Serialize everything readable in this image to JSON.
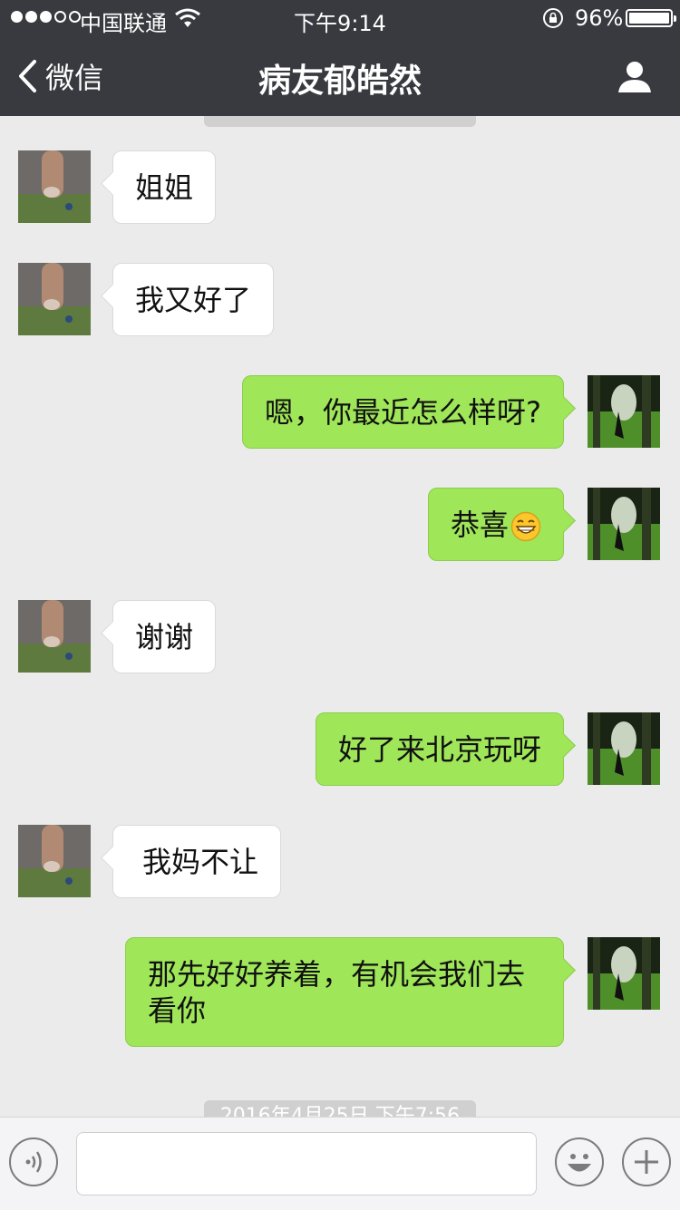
{
  "status_bar": {
    "carrier": "中国联通",
    "time": "下午9:14",
    "battery": "96%",
    "battery_level": 0.96,
    "signal_bars": 3
  },
  "nav": {
    "back_label": "微信",
    "title": "病友郁皓然"
  },
  "timestamps": {
    "bottom": "2016年4月25日 下午7:56"
  },
  "messages": [
    {
      "side": "left",
      "text": "姐姐"
    },
    {
      "side": "left",
      "text": "我又好了"
    },
    {
      "side": "right",
      "text": "嗯，你最近怎么样呀?"
    },
    {
      "side": "right",
      "text": "恭喜",
      "emoji": "grinning-face"
    },
    {
      "side": "left",
      "text": "谢谢"
    },
    {
      "side": "right",
      "text": "好了来北京玩呀"
    },
    {
      "side": "left",
      "text": "我妈不让"
    },
    {
      "side": "right",
      "text": "那先好好养着，有机会我们去看你"
    }
  ],
  "colors": {
    "nav_bg": "#393a3f",
    "chat_bg": "#ebebeb",
    "sent_bubble": "#9fe659",
    "received_bubble": "#ffffff"
  }
}
